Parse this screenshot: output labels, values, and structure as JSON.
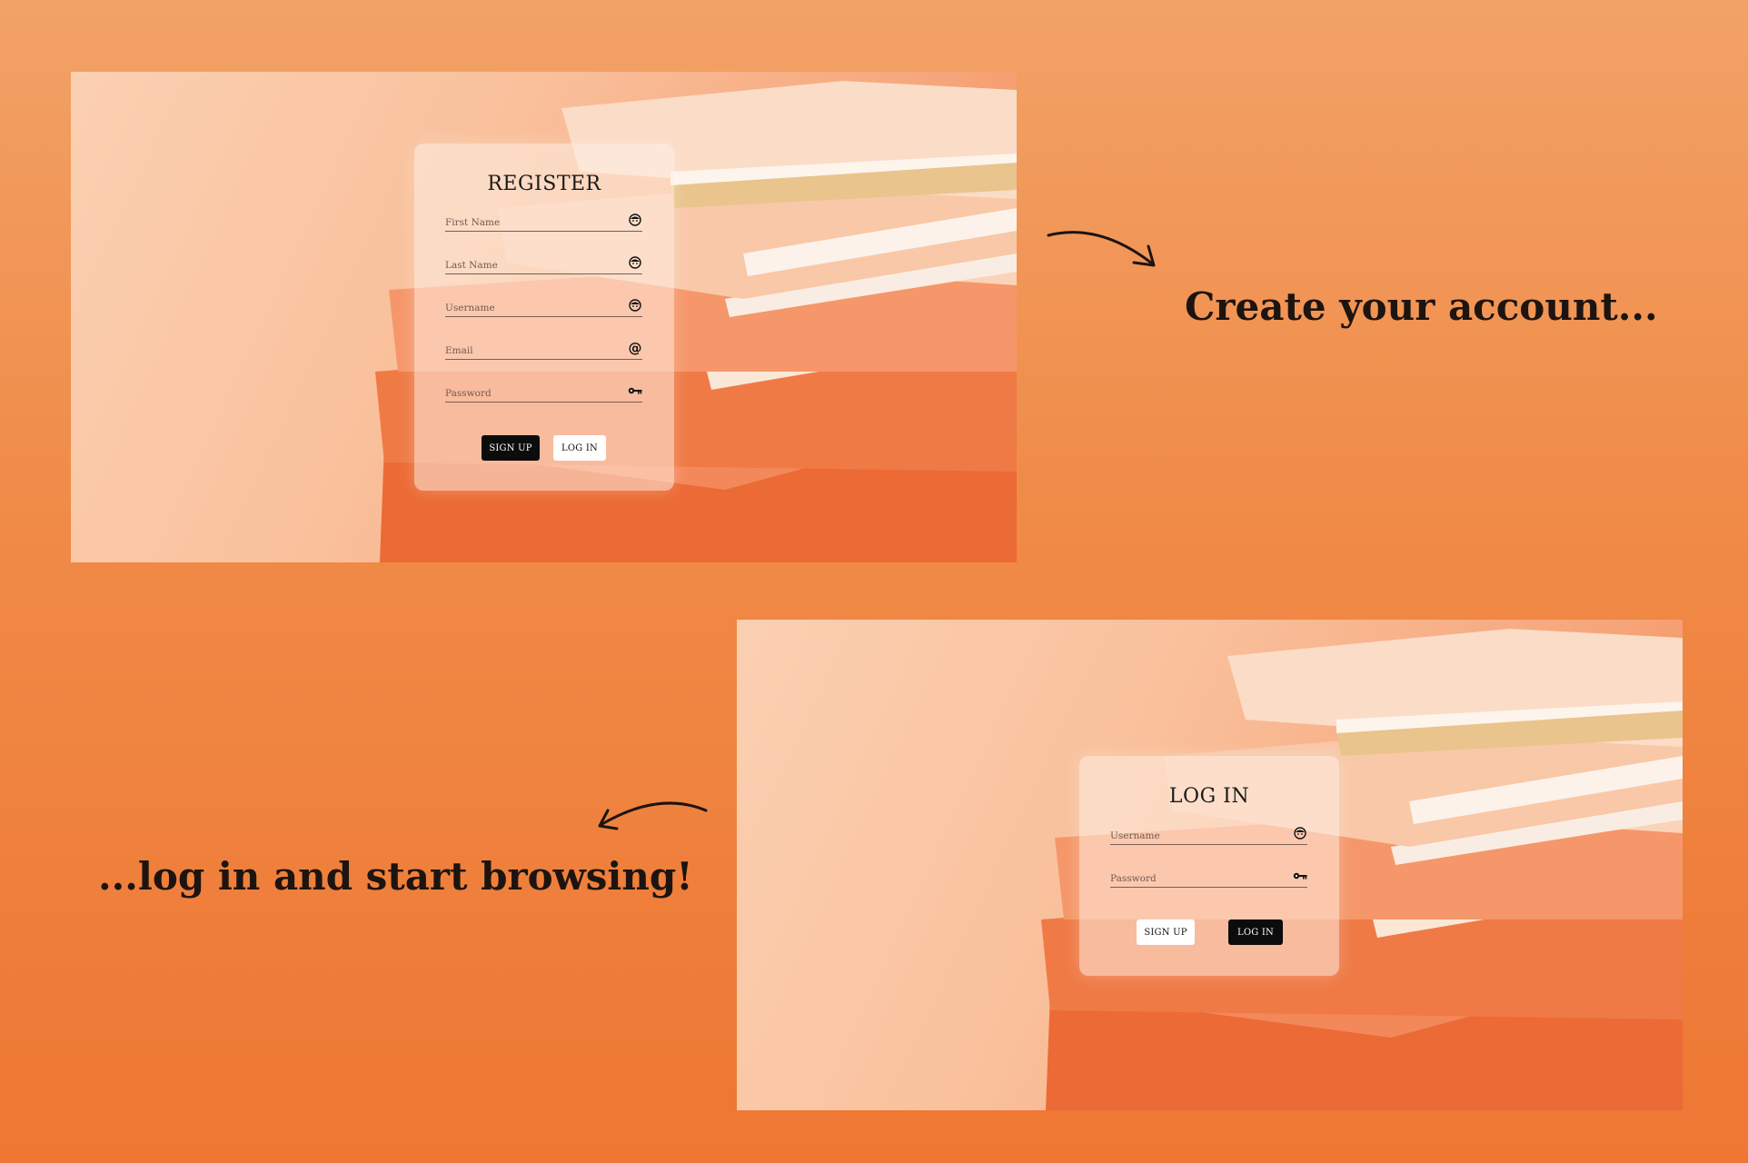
{
  "register_screen": {
    "title": "REGISTER",
    "fields": [
      {
        "placeholder": "First Name",
        "icon": "face-icon"
      },
      {
        "placeholder": "Last Name",
        "icon": "face-icon"
      },
      {
        "placeholder": "Username",
        "icon": "face-icon"
      },
      {
        "placeholder": "Email",
        "icon": "at-sign-icon"
      },
      {
        "placeholder": "Password",
        "icon": "key-icon"
      }
    ],
    "primary_button": "SIGN UP",
    "secondary_button": "LOG IN"
  },
  "login_screen": {
    "title": "LOG IN",
    "fields": [
      {
        "placeholder": "Username",
        "icon": "face-icon"
      },
      {
        "placeholder": "Password",
        "icon": "key-icon"
      }
    ],
    "secondary_button": "SIGN UP",
    "primary_button": "LOG IN"
  },
  "captions": {
    "register": "Create your account...",
    "login": "...log in and start browsing!"
  },
  "colors": {
    "background": "#ee7733",
    "card": "#fff0e6",
    "primary_button": "#0c0c0c",
    "text": "#1d1410"
  }
}
